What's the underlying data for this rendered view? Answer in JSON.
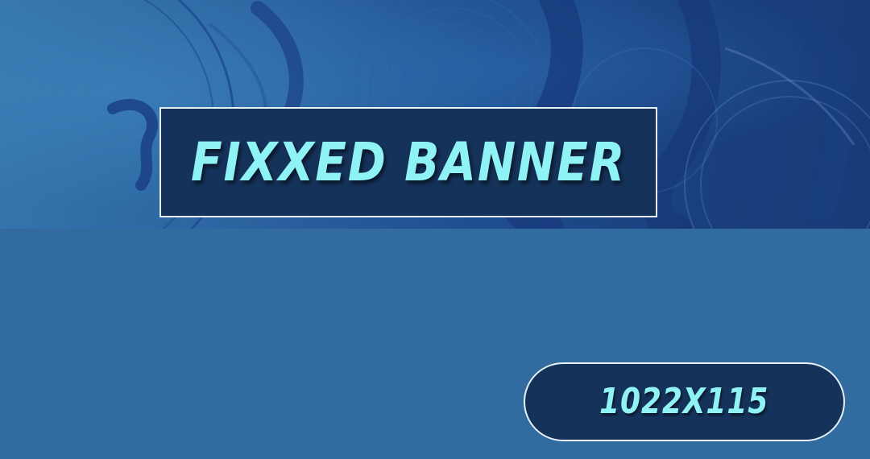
{
  "banner": {
    "title": "FIXXED BANNER",
    "size_label": "1022X115"
  },
  "colors": {
    "background": "#326ba0",
    "box_fill": "#15325a",
    "box_border": "#e6f0f8",
    "text": "#8ff3f5"
  }
}
